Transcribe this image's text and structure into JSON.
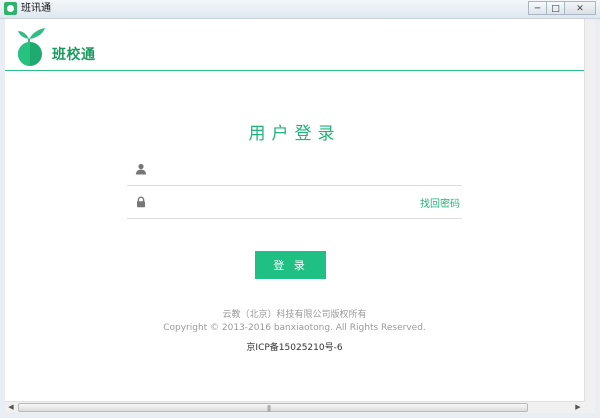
{
  "window": {
    "title": "班讯通",
    "minimize_glyph": "─",
    "maximize_glyph": "□",
    "close_glyph": "✕"
  },
  "header": {
    "brand": "班校通",
    "logo_icon": "sprout-logo-icon",
    "accent_color": "#22b27a"
  },
  "login": {
    "title": "用户登录",
    "username": {
      "icon": "user-icon",
      "value": "",
      "placeholder": ""
    },
    "password": {
      "icon": "lock-icon",
      "value": "",
      "placeholder": ""
    },
    "forgot_password": "找回密码",
    "submit_label": "登 录",
    "button_color": "#20bf84"
  },
  "footer": {
    "company": "云教（北京）科技有限公司版权所有",
    "copyright": "Copyright © 2013-2016 banxiaotong. All Rights Reserved.",
    "icp": "京ICP备15025210号-6"
  },
  "scrollbar": {
    "left_arrow": "◀",
    "right_arrow": "▶",
    "grip": "|||"
  }
}
